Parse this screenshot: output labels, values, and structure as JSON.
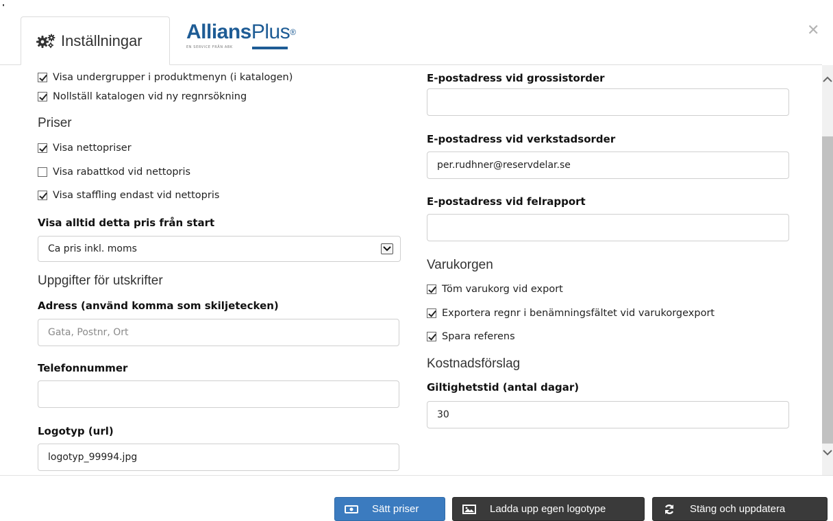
{
  "tabs": {
    "settings_label": "Inställningar",
    "brand": {
      "bold": "Allians",
      "light": "Plus",
      "mark": "®",
      "tagline": "EN SERVICE FRÅN ABK"
    }
  },
  "left": {
    "checks": [
      {
        "label": "Visa undergrupper i produktmenyn (i katalogen)",
        "checked": true
      },
      {
        "label": "Nollställ katalogen vid ny regnrsökning",
        "checked": true
      }
    ],
    "priser": {
      "heading": "Priser",
      "checks": [
        {
          "label": "Visa nettopriser",
          "checked": true
        },
        {
          "label": "Visa rabattkod vid nettopris",
          "checked": false
        },
        {
          "label": "Visa staffling endast vid nettopris",
          "checked": true
        }
      ],
      "start_price_label": "Visa alltid detta pris från start",
      "start_price_value": "Ca pris inkl. moms"
    },
    "print": {
      "heading": "Uppgifter för utskrifter",
      "address_label": "Adress (använd komma som skiljetecken)",
      "address_placeholder": "Gata, Postnr, Ort",
      "address_value": "",
      "phone_label": "Telefonnummer",
      "phone_value": "",
      "logo_label": "Logotyp (url)",
      "logo_value": "logotyp_99994.jpg"
    }
  },
  "right": {
    "email_wholesale_label": "E-postadress vid grossistorder",
    "email_wholesale_value": "",
    "email_workshop_label": "E-postadress vid verkstadsorder",
    "email_workshop_value": "per.rudhner@reservdelar.se",
    "email_error_label": "E-postadress vid felrapport",
    "email_error_value": "",
    "cart": {
      "heading": "Varukorgen",
      "checks": [
        {
          "label": "Töm varukorg vid export",
          "checked": true
        },
        {
          "label": "Exportera regnr i benämningsfältet vid varukorgexport",
          "checked": true
        },
        {
          "label": "Spara referens",
          "checked": true
        }
      ]
    },
    "estimate": {
      "heading": "Kostnadsförslag",
      "validity_label": "Giltighetstid (antal dagar)",
      "validity_value": "30"
    }
  },
  "footer": {
    "set_prices": "Sätt priser",
    "upload_logo": "Ladda upp egen logotype",
    "close_update": "Stäng och uppdatera"
  },
  "icons": {
    "tab": "gears-icon",
    "close": "close-icon",
    "set_prices": "money-icon",
    "upload_logo": "image-icon",
    "close_update": "refresh-icon"
  },
  "colors": {
    "primary": "#3b7bbf",
    "dark": "#3a3a3a",
    "brand": "#1e5c95"
  }
}
